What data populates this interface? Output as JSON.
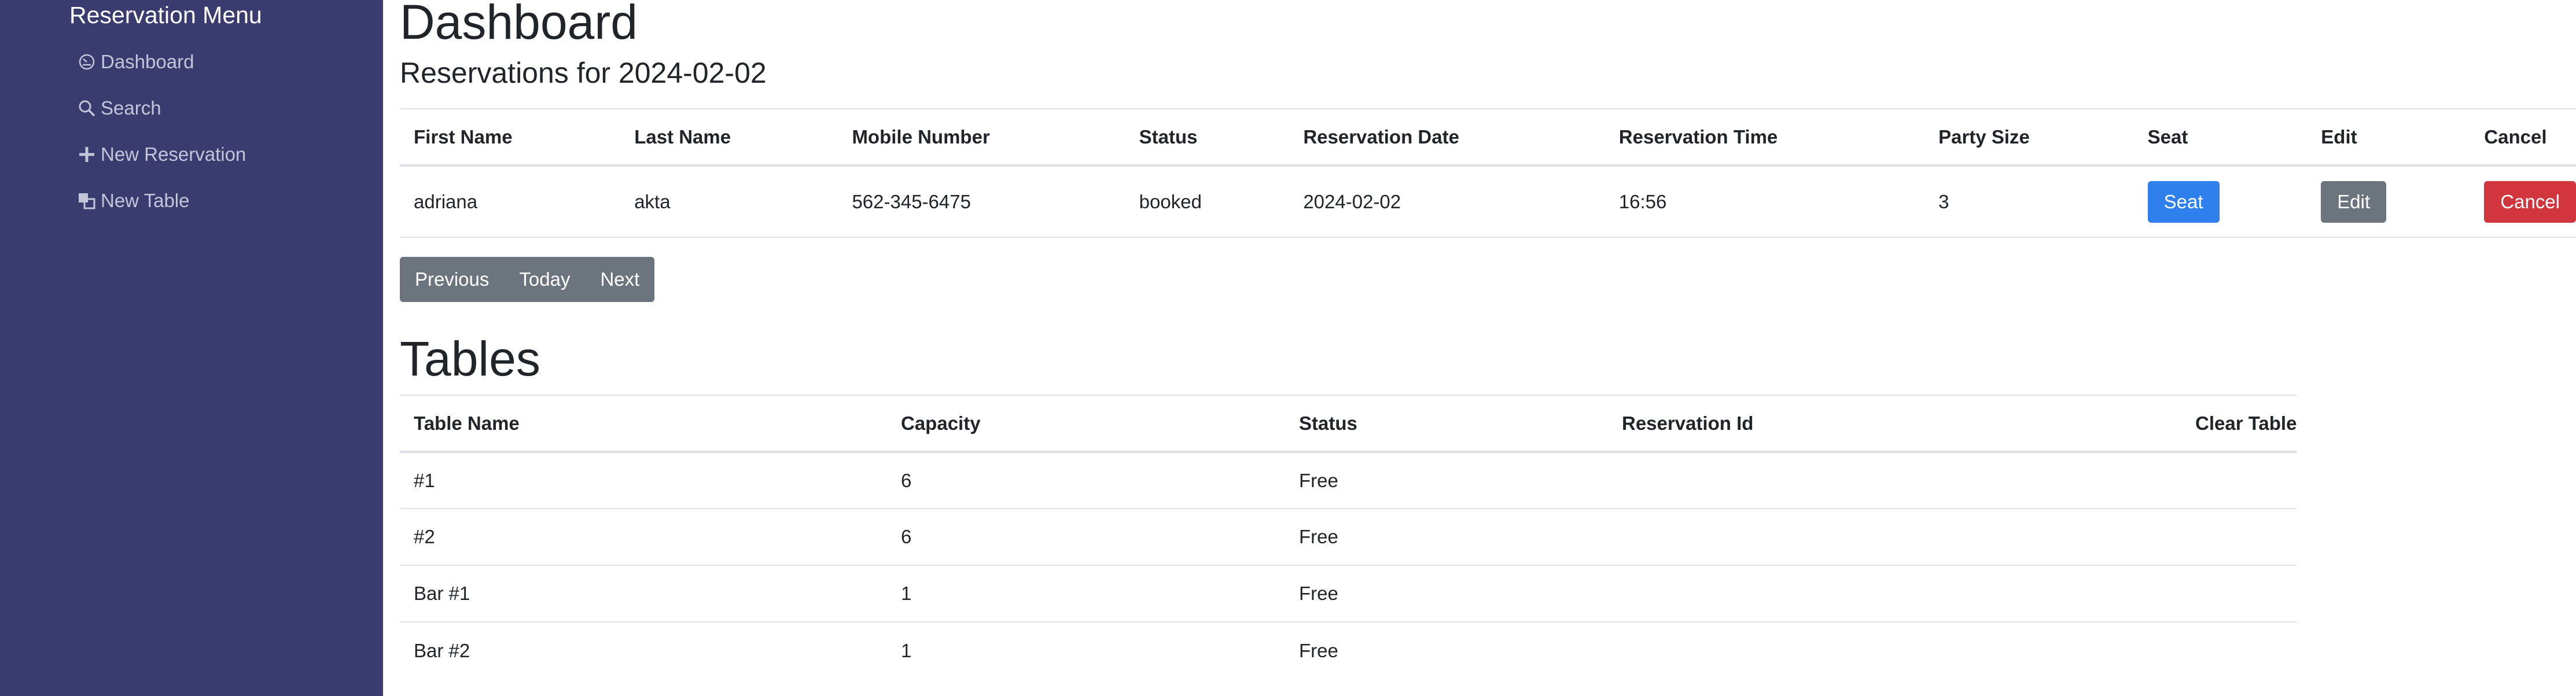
{
  "sidebar": {
    "title": "Reservation Menu",
    "items": [
      {
        "label": "Dashboard",
        "icon": "dashboard-icon"
      },
      {
        "label": "Search",
        "icon": "search-icon"
      },
      {
        "label": "New Reservation",
        "icon": "plus-icon"
      },
      {
        "label": "New Table",
        "icon": "table-icon"
      }
    ]
  },
  "main": {
    "title": "Dashboard",
    "reservations_heading": "Reservations for 2024-02-02",
    "reservations": {
      "columns": [
        "First Name",
        "Last Name",
        "Mobile Number",
        "Status",
        "Reservation Date",
        "Reservation Time",
        "Party Size",
        "Seat",
        "Edit",
        "Cancel"
      ],
      "rows": [
        {
          "first_name": "adriana",
          "last_name": "akta",
          "mobile_number": "562-345-6475",
          "status": "booked",
          "reservation_date": "2024-02-02",
          "reservation_time": "16:56",
          "party_size": "3",
          "seat_label": "Seat",
          "edit_label": "Edit",
          "cancel_label": "Cancel"
        }
      ]
    },
    "pager": {
      "previous": "Previous",
      "today": "Today",
      "next": "Next"
    },
    "tables_heading": "Tables",
    "tables": {
      "columns": [
        "Table Name",
        "Capacity",
        "Status",
        "Reservation Id",
        "Clear Table"
      ],
      "rows": [
        {
          "name": "#1",
          "capacity": "6",
          "status": "Free",
          "reservation_id": ""
        },
        {
          "name": "#2",
          "capacity": "6",
          "status": "Free",
          "reservation_id": ""
        },
        {
          "name": "Bar #1",
          "capacity": "1",
          "status": "Free",
          "reservation_id": ""
        },
        {
          "name": "Bar #2",
          "capacity": "1",
          "status": "Free",
          "reservation_id": ""
        }
      ]
    }
  },
  "colors": {
    "sidebar_bg": "#3a3b6e",
    "seat_button": "#2f80ed",
    "edit_button": "#6c757d",
    "cancel_button": "#d1363f"
  }
}
